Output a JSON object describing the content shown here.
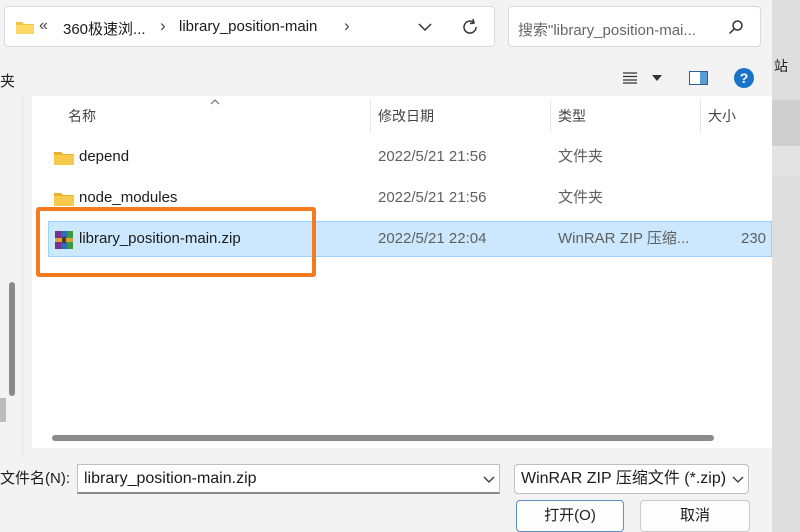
{
  "address_bar": {
    "overflow": "«",
    "crumb_parent": "360极速浏...",
    "crumb_current": "library_position-main",
    "chevron_after_parent": "›",
    "chevron_after_current": "›"
  },
  "search": {
    "placeholder": "搜索\"library_position-mai..."
  },
  "toolbar": {
    "left_clip": "夹",
    "right_clip": "站",
    "help": "?"
  },
  "columns": {
    "name": "名称",
    "date": "修改日期",
    "type": "类型",
    "size": "大小"
  },
  "files": [
    {
      "name": "depend",
      "date": "2022/5/21 21:56",
      "type": "文件夹",
      "size": "",
      "icon": "folder-icon"
    },
    {
      "name": "node_modules",
      "date": "2022/5/21 21:56",
      "type": "文件夹",
      "size": "",
      "icon": "folder-icon"
    },
    {
      "name": "library_position-main.zip",
      "date": "2022/5/21 22:04",
      "type": "WinRAR ZIP 压缩...",
      "size": "230",
      "icon": "winrar-zip-icon",
      "selected": true
    }
  ],
  "bottom": {
    "filename_label": "文件名(N):",
    "filename_value": "library_position-main.zip",
    "filetype_value": "WinRAR ZIP 压缩文件 (*.zip)",
    "open_button": "打开(O)",
    "cancel_button": "取消"
  },
  "colors": {
    "selection_bg": "#cce8ff",
    "highlight_box": "#f47a20",
    "help_icon": "#1a73c8",
    "folder": "#f5c342"
  }
}
